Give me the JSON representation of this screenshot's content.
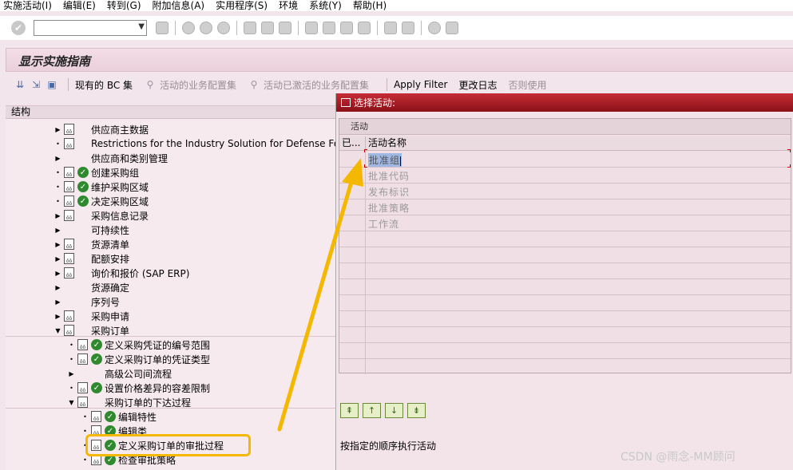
{
  "menu": [
    "实施活动(I)",
    "编辑(E)",
    "转到(G)",
    "附加信息(A)",
    "实用程序(S)",
    "环境",
    "系统(Y)",
    "帮助(H)"
  ],
  "screen_title": "显示实施指南",
  "app_toolbar": {
    "existing_bc": "现有的 BC 集",
    "active_bc": "活动的业务配置集",
    "active_activated_bc": "活动已激活的业务配置集",
    "apply_filter": "Apply Filter",
    "change_log": "更改日志",
    "unused": "否则使用"
  },
  "tree": {
    "header": "结构",
    "nodes": [
      {
        "label": "供应商主数据"
      },
      {
        "label": "Restrictions for the Industry Solution for Defense Forc"
      },
      {
        "label": "供应商和类别管理"
      },
      {
        "label": "创建采购组"
      },
      {
        "label": "维护采购区域"
      },
      {
        "label": "决定采购区域"
      },
      {
        "label": "采购信息记录"
      },
      {
        "label": "可持续性"
      },
      {
        "label": "货源清单"
      },
      {
        "label": "配额安排"
      },
      {
        "label": "询价和报价 (SAP ERP)"
      },
      {
        "label": "货源确定"
      },
      {
        "label": "序列号"
      },
      {
        "label": "采购申请"
      },
      {
        "label": "采购订单"
      },
      {
        "label": "定义采购凭证的编号范围"
      },
      {
        "label": "定义采购订单的凭证类型"
      },
      {
        "label": "高级公司间流程"
      },
      {
        "label": "设置价格差异的容差限制"
      },
      {
        "label": "采购订单的下达过程"
      },
      {
        "label": "编辑特性"
      },
      {
        "label": "编辑类"
      },
      {
        "label": "定义采购订单的审批过程"
      },
      {
        "label": "检查审批策略"
      }
    ]
  },
  "popup": {
    "title": "选择活动:",
    "group_header": "活动",
    "col_done": "已...",
    "col_name": "活动名称",
    "rows": [
      "批准组",
      "批准代码",
      "发布标识",
      "批准策略",
      "工作流"
    ],
    "status_text": "按指定的顺序执行活动"
  },
  "watermark": "CSDN @雨念-MM顾问"
}
